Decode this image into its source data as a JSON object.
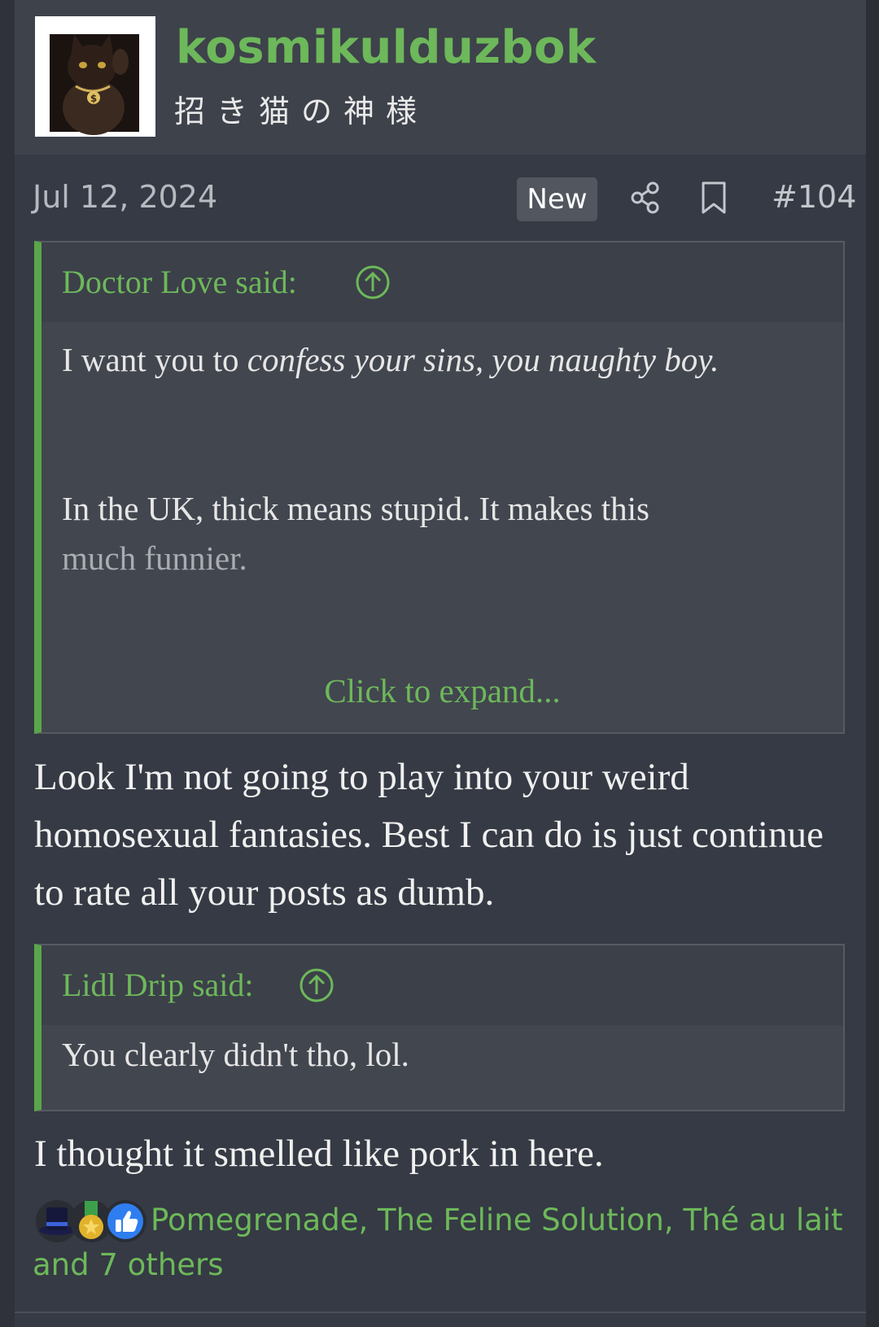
{
  "user": {
    "name": "kosmikulduzbok",
    "title": "招き猫の神様"
  },
  "post": {
    "date": "Jul 12, 2024",
    "badge": "New",
    "number": "#104",
    "icons": {
      "share": "share-icon",
      "bookmark": "bookmark-icon",
      "jump": "arrow-up-circle-icon"
    }
  },
  "quote1": {
    "author_said": "Doctor Love said:",
    "line1_plain": "I want you to ",
    "line1_italic": "confess your sins, you naughty boy.",
    "line2": "In the UK, thick means stupid. It makes this",
    "line3": "much funnier.",
    "expand": "Click to expand..."
  },
  "reply1": "Look I'm not going to play into your weird homosexual fantasies. Best I can do is just continue to rate all your posts as dumb.",
  "quote2": {
    "author_said": "Lidl Drip said:",
    "text": "You clearly didn't tho, lol."
  },
  "reply2": "I thought it smelled like pork in here.",
  "reactions": {
    "icons": [
      "top-hat-icon",
      "medal-icon",
      "thumbs-up-icon"
    ],
    "users": "Pomegrenade, The Feline Solution, Thé au lait and 7 others"
  },
  "colors": {
    "accent": "#6db85a",
    "background": "#353a44",
    "quote_bg": "#42464f"
  }
}
